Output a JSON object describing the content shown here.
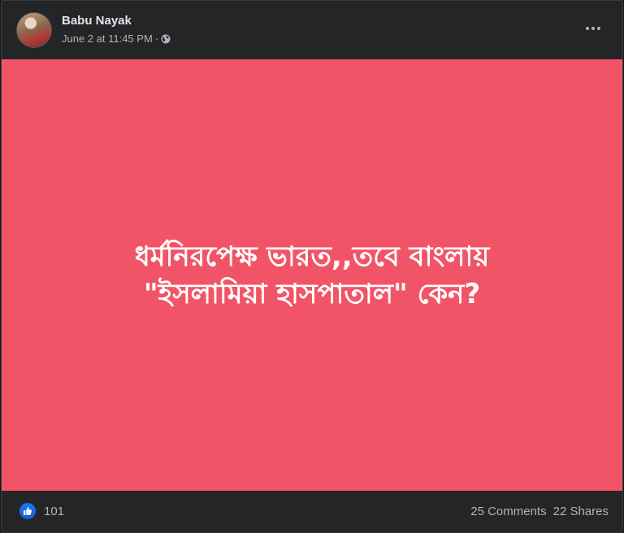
{
  "post": {
    "author": "Babu Nayak",
    "timestamp": "June 2 at 11:45 PM",
    "separator": "·",
    "privacy_icon": "globe-icon",
    "menu_icon": "more-options-icon",
    "text_line1": "ধর্মনিরপেক্ষ ভারত,,তবে বাংলায়",
    "text_line2": "\"ইসলামিয়া হাসপাতাল\" কেন?",
    "background_color": "#f25467"
  },
  "footer": {
    "like_icon": "like-thumb-icon",
    "likes": "101",
    "comments": "25 Comments",
    "shares": "22 Shares"
  }
}
